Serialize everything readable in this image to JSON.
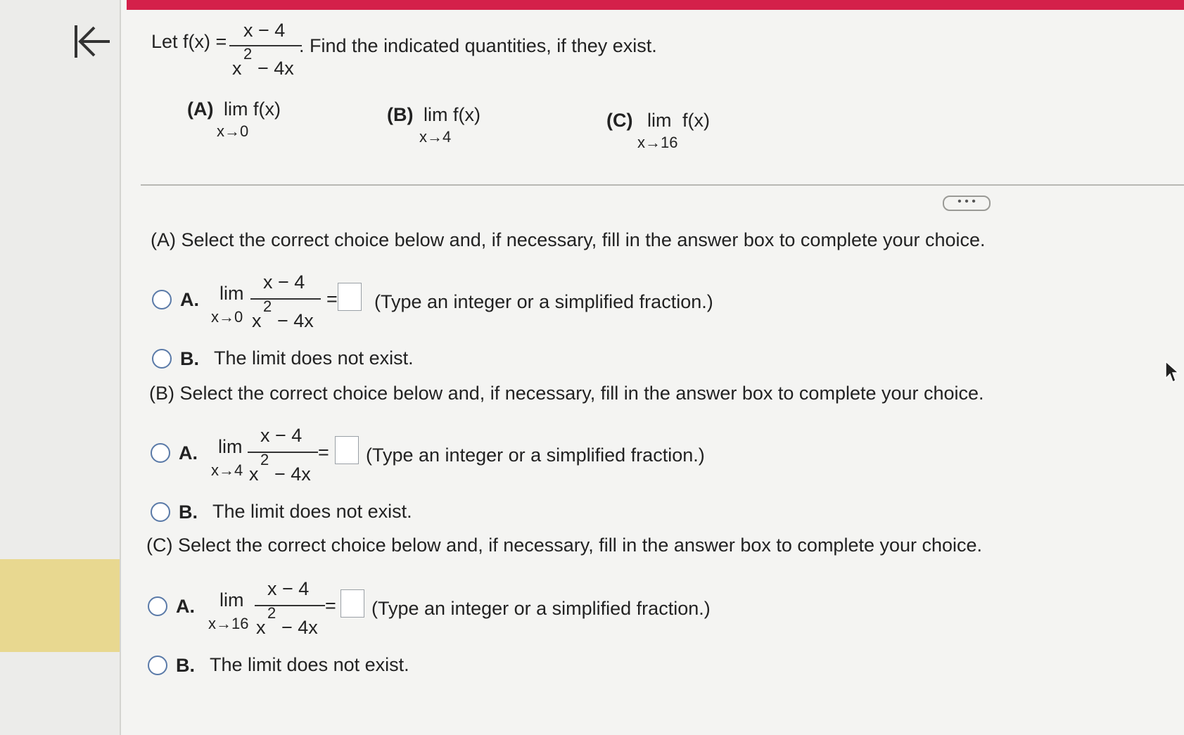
{
  "colors": {
    "accent": "#d4204a",
    "highlight": "#e8d890"
  },
  "question": {
    "prefix": "Let f(x) =",
    "num": "x − 4",
    "den_x": "x",
    "den_exp": "2",
    "den_rest": "− 4x",
    "suffix": ". Find the indicated quantities, if they exist."
  },
  "parts": [
    {
      "label": "(A)",
      "lim": "lim",
      "func": "f(x)",
      "sub": "x→0"
    },
    {
      "label": "(B)",
      "lim": "lim",
      "func": "f(x)",
      "sub": "x→4"
    },
    {
      "label": "(C)",
      "lim": "lim",
      "func": "f(x)",
      "sub": "x→16"
    }
  ],
  "more_button": "• • •",
  "sections": [
    {
      "heading": "(A) Select the correct choice below and, if necessary, fill in the answer box to complete your choice.",
      "a_letter": "A.",
      "lim": "lim",
      "sub": "x→0",
      "num": "x − 4",
      "den_x": "x",
      "den_exp": "2",
      "den_rest": "− 4x",
      "equals": "=",
      "hint": "(Type an integer or a simplified fraction.)",
      "b_letter": "B.",
      "b_text": "The limit does not exist.",
      "answer": ""
    },
    {
      "heading": "(B) Select the correct choice below and, if necessary, fill in the answer box to complete your choice.",
      "a_letter": "A.",
      "lim": "lim",
      "sub": "x→4",
      "num": "x − 4",
      "den_x": "x",
      "den_exp": "2",
      "den_rest": "− 4x",
      "equals": "=",
      "hint": "(Type an integer or a simplified fraction.)",
      "b_letter": "B.",
      "b_text": "The limit does not exist.",
      "answer": ""
    },
    {
      "heading": "(C) Select the correct choice below and, if necessary, fill in the answer box to complete your choice.",
      "a_letter": "A.",
      "lim": "lim",
      "sub": "x→16",
      "num": "x − 4",
      "den_x": "x",
      "den_exp": "2",
      "den_rest": "− 4x",
      "equals": "=",
      "hint": "(Type an integer or a simplified fraction.)",
      "b_letter": "B.",
      "b_text": "The limit does not exist.",
      "answer": ""
    }
  ]
}
